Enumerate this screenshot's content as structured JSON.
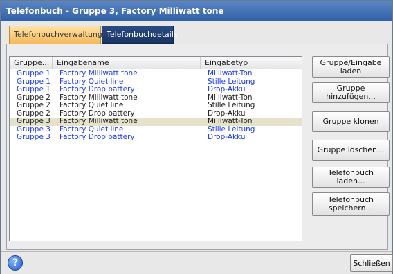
{
  "window": {
    "title": "Telefonbuch - Gruppe 3, Factory Milliwatt tone"
  },
  "tabs": [
    {
      "label": "Telefonbuchverwaltung"
    },
    {
      "label": "Telefonbuchdetails"
    }
  ],
  "table": {
    "columns": [
      "Gruppe...",
      "Eingabename",
      "Eingabetyp"
    ],
    "rows": [
      {
        "group": "Gruppe 1",
        "name": "Factory Milliwatt tone",
        "type": "Milliwatt-Ton",
        "color": "#1a3cff"
      },
      {
        "group": "Gruppe 1",
        "name": "Factory Quiet line",
        "type": "Stille Leitung",
        "color": "#1a3cff"
      },
      {
        "group": "Gruppe 1",
        "name": "Factory Drop battery",
        "type": "Drop-Akku",
        "color": "#1a3cff"
      },
      {
        "group": "Gruppe 2",
        "name": "Factory Milliwatt tone",
        "type": "Milliwatt-Ton",
        "color": "#222222"
      },
      {
        "group": "Gruppe 2",
        "name": "Factory Quiet line",
        "type": "Stille Leitung",
        "color": "#222222"
      },
      {
        "group": "Gruppe 2",
        "name": "Factory Drop battery",
        "type": "Drop-Akku",
        "color": "#222222"
      },
      {
        "group": "Gruppe 3",
        "name": "Factory Milliwatt tone",
        "type": "Milliwatt-Ton",
        "color": "#222222",
        "selected": true
      },
      {
        "group": "Gruppe 3",
        "name": "Factory Quiet line",
        "type": "Stille Leitung",
        "color": "#1a3cff"
      },
      {
        "group": "Gruppe 3",
        "name": "Factory Drop battery",
        "type": "Drop-Akku",
        "color": "#1a3cff"
      }
    ]
  },
  "buttons": {
    "load_group_entry_1": "Gruppe/Eingabe",
    "load_group_entry_2": "laden",
    "add_group": "Gruppe hinzufügen...",
    "clone_group": "Gruppe klonen",
    "delete_group": "Gruppe löschen...",
    "load_phonebook": "Telefonbuch laden...",
    "save_phonebook_1": "Telefonbuch",
    "save_phonebook_2": "speichern..."
  },
  "footer": {
    "help_icon": "help-icon",
    "close_label": "Schließen"
  },
  "colors": {
    "titlebar": "#3b6bb4",
    "active_tab": "#f5b85a",
    "inactive_tab": "#183565",
    "link_blue": "#1a3cff",
    "selected_row": "#e5e2cc"
  }
}
